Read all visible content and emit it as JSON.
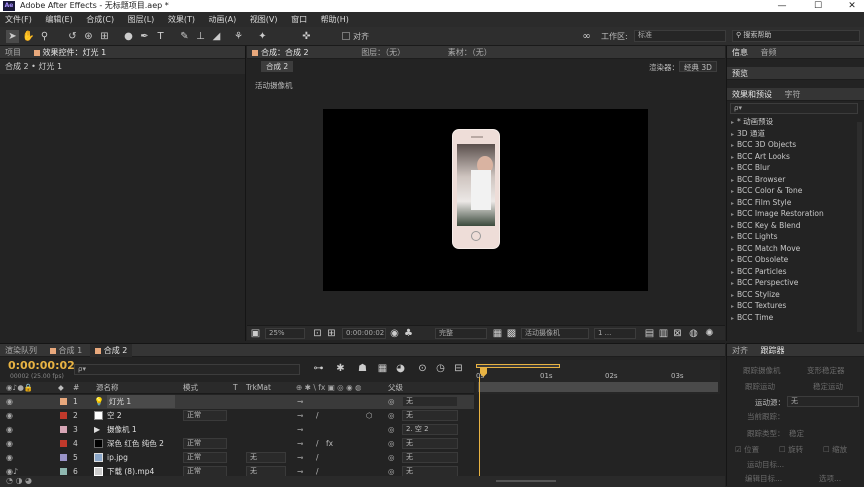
{
  "window": {
    "title": "Adobe After Effects - 无标题项目.aep *",
    "logo": "Ae",
    "min": "—",
    "max": "☐",
    "close": "✕"
  },
  "menu": [
    "文件(F)",
    "编辑(E)",
    "合成(C)",
    "图层(L)",
    "效果(T)",
    "动画(A)",
    "视图(V)",
    "窗口",
    "帮助(H)"
  ],
  "toolbar": {
    "align_label": "对齐",
    "workspace_label": "工作区:",
    "workspace_value": "标准",
    "search_help_placeholder": "搜索帮助"
  },
  "project_panel": {
    "tab_project": "项目",
    "tab_effect_controls": "效果控件：灯光 1",
    "breadcrumb": "合成 2 • 灯光 1"
  },
  "comp_viewer": {
    "tab_comp": "合成：合成 2",
    "tab_layer": "图层：（无）",
    "tab_footage": "素材：（无）",
    "comp_chip": "合成 2",
    "renderer_label": "渲染器：",
    "renderer_value": "经典 3D",
    "active_camera": "活动摄像机",
    "zoom": "25%",
    "timecode": "0:00:00:02",
    "quality": "完整",
    "view": "活动摄像机",
    "views_count": "1 ..."
  },
  "right_panels": {
    "info_tab": "信息",
    "audio_tab": "音频",
    "preview_tab": "预览",
    "effects_tab": "效果和预设",
    "chars_tab": "字符",
    "search_placeholder": "ρ▾",
    "effects": [
      "* 动画预设",
      "3D 通道",
      "BCC 3D Objects",
      "BCC Art Looks",
      "BCC Blur",
      "BCC Browser",
      "BCC Color & Tone",
      "BCC Film Style",
      "BCC Image Restoration",
      "BCC Key & Blend",
      "BCC Lights",
      "BCC Match Move",
      "BCC Obsolete",
      "BCC Particles",
      "BCC Perspective",
      "BCC Stylize",
      "BCC Textures",
      "BCC Time"
    ]
  },
  "timeline": {
    "tab_render": "渲染队列",
    "tab_comp1": "合成 1",
    "tab_comp2": "合成 2",
    "timecode": "0:00:00:02",
    "fps": "00002 (25.00 fps)",
    "col_num": "#",
    "col_name": "源名称",
    "col_mode": "模式",
    "col_t": "T",
    "col_trkmat": "TrkMat",
    "col_parent": "父级",
    "ruler": [
      "0s",
      "01s",
      "02s",
      "03s"
    ],
    "layers": [
      {
        "num": "1",
        "name": "灯光 1",
        "mode": "",
        "parent": "无",
        "label_color": "#e8a87c",
        "bar_color": "#d9a98e"
      },
      {
        "num": "2",
        "name": "空 2",
        "mode": "正常",
        "parent": "无",
        "label_color": "#c0392b",
        "bar_color": "#b44a52"
      },
      {
        "num": "3",
        "name": "摄像机 1",
        "mode": "",
        "parent": "2. 空 2",
        "label_color": "#d6a5b5",
        "bar_color": "#c98fa2"
      },
      {
        "num": "4",
        "name": "深色 红色 纯色 2",
        "mode": "正常",
        "parent": "无",
        "label_color": "#c0392b",
        "bar_color": "#a9414d"
      },
      {
        "num": "5",
        "name": "ip.jpg",
        "mode": "正常",
        "trkmat": "无",
        "parent": "无",
        "label_color": "#9a94c8",
        "bar_color": "#8e86b8"
      },
      {
        "num": "6",
        "name": "下载 (8).mp4",
        "mode": "正常",
        "trkmat": "无",
        "parent": "无",
        "label_color": "#8fb8b0",
        "bar_color": "#7ea89c"
      }
    ]
  },
  "tracker": {
    "tab_align": "对齐",
    "tab_tracker": "跟踪器",
    "track_camera": "跟踪摄像机",
    "warp_stabilizer": "变形稳定器",
    "track_motion": "跟踪运动",
    "stabilize_motion": "稳定运动",
    "motion_source_label": "运动源：",
    "motion_source_value": "无",
    "current_track": "当前跟踪：",
    "track_type": "跟踪类型：",
    "track_type_value": "稳定",
    "position": "位置",
    "rotation": "旋转",
    "scale": "缩放",
    "motion_target": "运动目标...",
    "edit_target": "编辑目标...",
    "options": "选项..."
  }
}
